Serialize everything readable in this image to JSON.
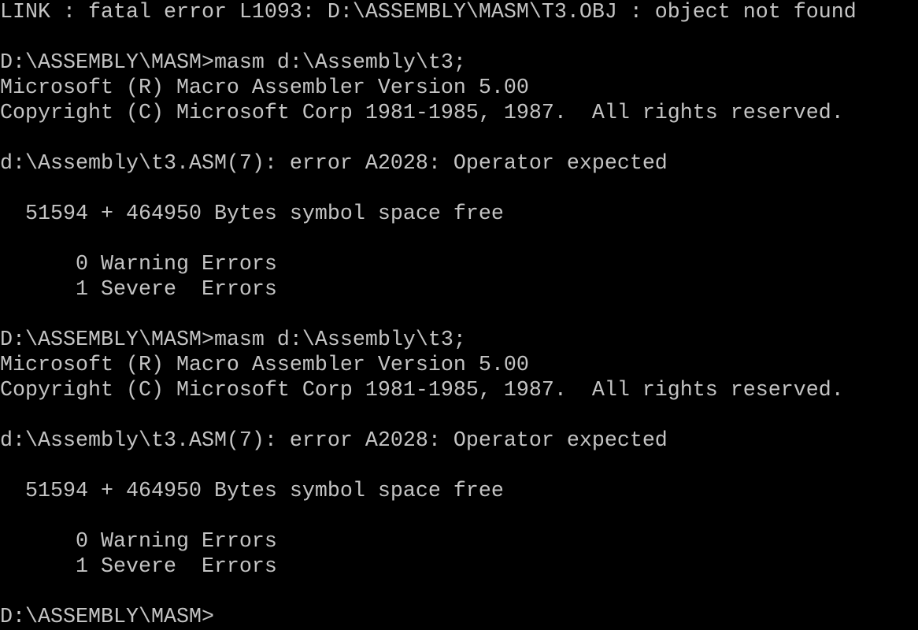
{
  "console": {
    "text_color": "#c4c4c4",
    "background_color": "#000000",
    "lines": [
      "LINK : fatal error L1093: D:\\ASSEMBLY\\MASM\\T3.OBJ : object not found",
      "",
      "D:\\ASSEMBLY\\MASM>masm d:\\Assembly\\t3;",
      "Microsoft (R) Macro Assembler Version 5.00",
      "Copyright (C) Microsoft Corp 1981-1985, 1987.  All rights reserved.",
      "",
      "d:\\Assembly\\t3.ASM(7): error A2028: Operator expected",
      "",
      "  51594 + 464950 Bytes symbol space free",
      "",
      "      0 Warning Errors",
      "      1 Severe  Errors",
      "",
      "D:\\ASSEMBLY\\MASM>masm d:\\Assembly\\t3;",
      "Microsoft (R) Macro Assembler Version 5.00",
      "Copyright (C) Microsoft Corp 1981-1985, 1987.  All rights reserved.",
      "",
      "d:\\Assembly\\t3.ASM(7): error A2028: Operator expected",
      "",
      "  51594 + 464950 Bytes symbol space free",
      "",
      "      0 Warning Errors",
      "      1 Severe  Errors",
      "",
      "D:\\ASSEMBLY\\MASM>"
    ]
  }
}
